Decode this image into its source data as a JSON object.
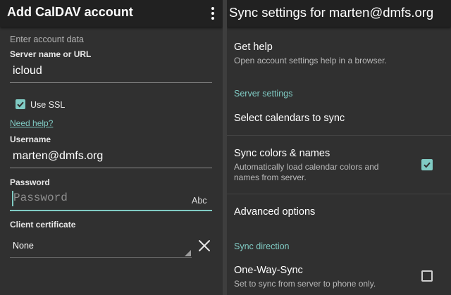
{
  "left": {
    "title": "Add CalDAV account",
    "section_label": "Enter account data",
    "server": {
      "label": "Server name or URL",
      "value": "icloud"
    },
    "use_ssl": {
      "label": "Use SSL",
      "checked": true
    },
    "help_link": "Need help?",
    "username": {
      "label": "Username",
      "value": "marten@dmfs.org"
    },
    "password": {
      "label": "Password",
      "placeholder": "Password",
      "keyboard_hint": "Abc"
    },
    "certificate": {
      "label": "Client certificate",
      "value": "None"
    }
  },
  "right": {
    "title": "Sync settings for marten@dmfs.org",
    "get_help": {
      "title": "Get help",
      "summary": "Open account settings help in a browser."
    },
    "server_settings_header": "Server settings",
    "select_calendars": {
      "title": "Select calendars to sync"
    },
    "sync_colors": {
      "title": "Sync colors & names",
      "summary_line1": "Automatically load calendar colors and",
      "summary_line2": "names from server.",
      "checked": true
    },
    "advanced_options": {
      "title": "Advanced options"
    },
    "sync_direction_header": "Sync direction",
    "one_way_sync": {
      "title": "One-Way-Sync",
      "summary": "Set to sync from server to phone only.",
      "checked": false
    }
  },
  "colors": {
    "accent": "#80cbc4",
    "toolbar": "#212121",
    "background": "#303030"
  },
  "icons": [
    "overflow-menu-icon",
    "checkmark-icon",
    "close-icon",
    "dropdown-corner-icon"
  ]
}
